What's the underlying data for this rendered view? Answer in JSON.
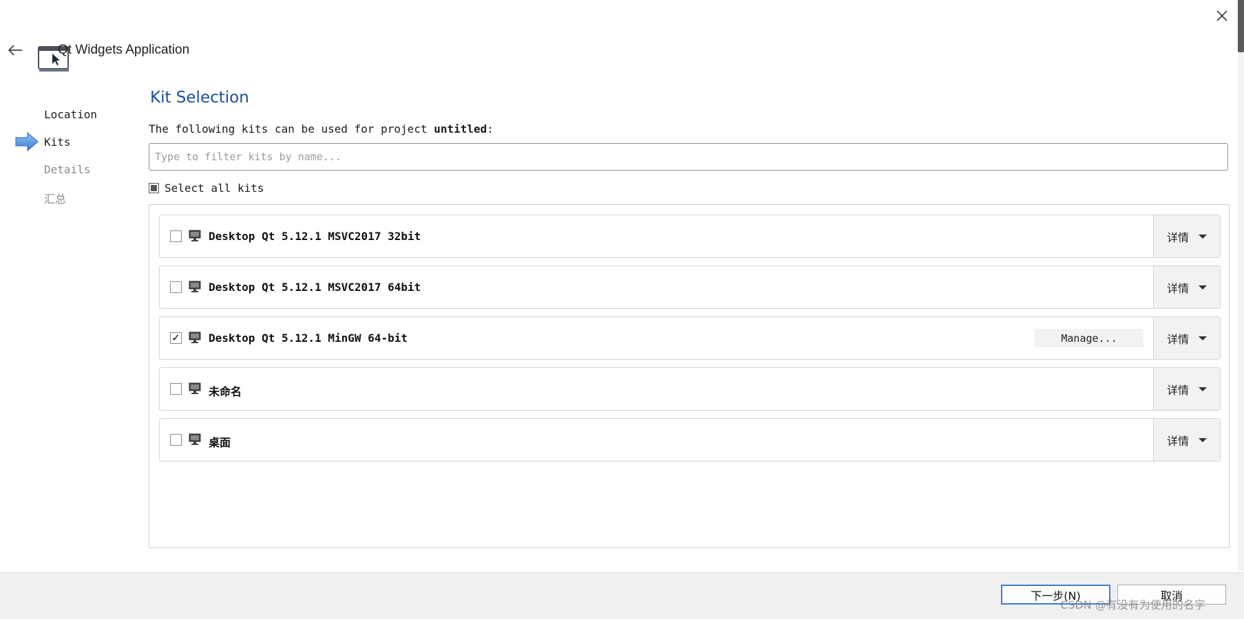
{
  "window": {
    "close_icon": "close-icon",
    "back_icon": "back-arrow-icon",
    "title": "Qt Widgets Application"
  },
  "steps": [
    {
      "label": "Location",
      "state": "done"
    },
    {
      "label": "Kits",
      "state": "current"
    },
    {
      "label": "Details",
      "state": "pending"
    },
    {
      "label": "汇总",
      "state": "pending"
    }
  ],
  "main": {
    "title": "Kit Selection",
    "intro_prefix": "The following kits can be used for project ",
    "project_name": "untitled",
    "intro_suffix": ":",
    "filter": {
      "value": "",
      "placeholder": "Type to filter kits by name..."
    },
    "select_all_label": "Select all kits",
    "select_all_state": "partial",
    "kits": [
      {
        "name": "Desktop Qt 5.12.1 MSVC2017 32bit",
        "checked": false,
        "details_label": "详情"
      },
      {
        "name": "Desktop Qt 5.12.1 MSVC2017 64bit",
        "checked": false,
        "details_label": "详情"
      },
      {
        "name": "Desktop Qt 5.12.1 MinGW 64-bit",
        "checked": true,
        "manage_label": "Manage...",
        "details_label": "详情"
      },
      {
        "name": "未命名",
        "checked": false,
        "details_label": "详情"
      },
      {
        "name": "桌面",
        "checked": false,
        "details_label": "详情"
      }
    ]
  },
  "footer": {
    "next_label": "下一步(N)",
    "cancel_label": "取消",
    "watermark": "CSDN @有没有为使用的名字"
  },
  "colors": {
    "title_blue": "#1b4f9a",
    "step_arrow": "#4a8fe0",
    "next_border": "#3e7bd6"
  }
}
